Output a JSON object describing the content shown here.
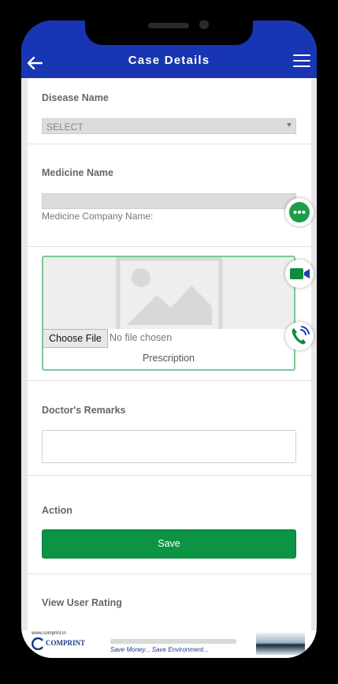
{
  "header": {
    "title": "Case Details",
    "back_icon": "arrow-left-icon",
    "menu_icon": "hamburger-menu-icon",
    "background_color": "#1835b3"
  },
  "disease": {
    "label": "Disease Name",
    "select_value": "SELECT"
  },
  "medicine": {
    "label": "Medicine Name",
    "select_value": "",
    "company_label": "Medicine Company Name:"
  },
  "prescription": {
    "choose_file_label": "Choose File",
    "file_status": "No file chosen",
    "caption": "Prescription",
    "image_icon": "image-placeholder-icon"
  },
  "remarks": {
    "label": "Doctor's Remarks",
    "value": ""
  },
  "action": {
    "label": "Action",
    "save_label": "Save",
    "save_color": "#0c9444"
  },
  "rating": {
    "label": "View User Rating"
  },
  "floating_buttons": [
    {
      "icon": "chat-icon",
      "color": "#1e9e4a"
    },
    {
      "icon": "video-call-icon",
      "color": "#0f8c3c"
    },
    {
      "icon": "phone-call-icon",
      "color": "#0f8c3c"
    }
  ],
  "banner": {
    "url": "www.comprint.in",
    "brand": "COMPRINT",
    "tagline": "Save Money... Save Environment..."
  }
}
